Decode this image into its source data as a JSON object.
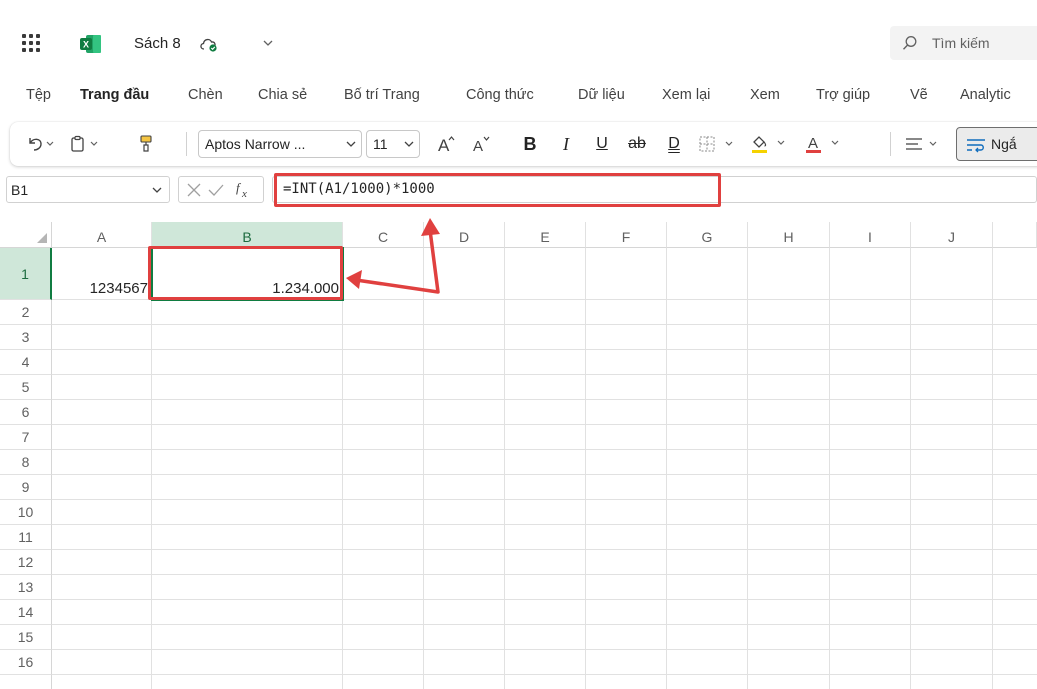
{
  "titlebar": {
    "doc_title": "Sách 8",
    "search_placeholder": "Tìm kiếm"
  },
  "tabs": [
    {
      "label": "Tệp",
      "active": false
    },
    {
      "label": "Trang đầu",
      "active": true
    },
    {
      "label": "Chèn",
      "active": false
    },
    {
      "label": "Chia sẻ",
      "active": false
    },
    {
      "label": "Bố trí Trang",
      "active": false
    },
    {
      "label": "Công thức",
      "active": false
    },
    {
      "label": "Dữ liệu",
      "active": false
    },
    {
      "label": "Xem lại",
      "active": false
    },
    {
      "label": "Xem",
      "active": false
    },
    {
      "label": "Trợ giúp",
      "active": false
    },
    {
      "label": "Vẽ",
      "active": false
    },
    {
      "label": "Analytic",
      "active": false
    }
  ],
  "ribbon": {
    "font_name": "Aptos Narrow ...",
    "font_size": "11",
    "bold_glyph": "B",
    "italic_glyph": "I",
    "underline_glyph": "U",
    "strike_glyph": "ab",
    "double_underline_glyph": "D",
    "wrap_label": "Ngắ",
    "font_color_accent": "#e0403f",
    "fill_color_accent": "#f5d200"
  },
  "formula_bar": {
    "name_box": "B1",
    "formula": "=INT(A1/1000)*1000"
  },
  "grid": {
    "columns": [
      "A",
      "B",
      "C",
      "D",
      "E",
      "F",
      "G",
      "H",
      "I",
      "J"
    ],
    "rows": [
      "1",
      "2",
      "3",
      "4",
      "5",
      "6",
      "7",
      "8",
      "9",
      "10",
      "11",
      "12",
      "13",
      "14",
      "15",
      "16"
    ],
    "selected_column": "B",
    "selected_row": "1",
    "cells": {
      "A1": "1234567",
      "B1": "1.234.000"
    }
  },
  "colors": {
    "excel_green": "#107c41",
    "selection_fill": "#cfe7d9",
    "annotation_red": "#e0403f"
  }
}
